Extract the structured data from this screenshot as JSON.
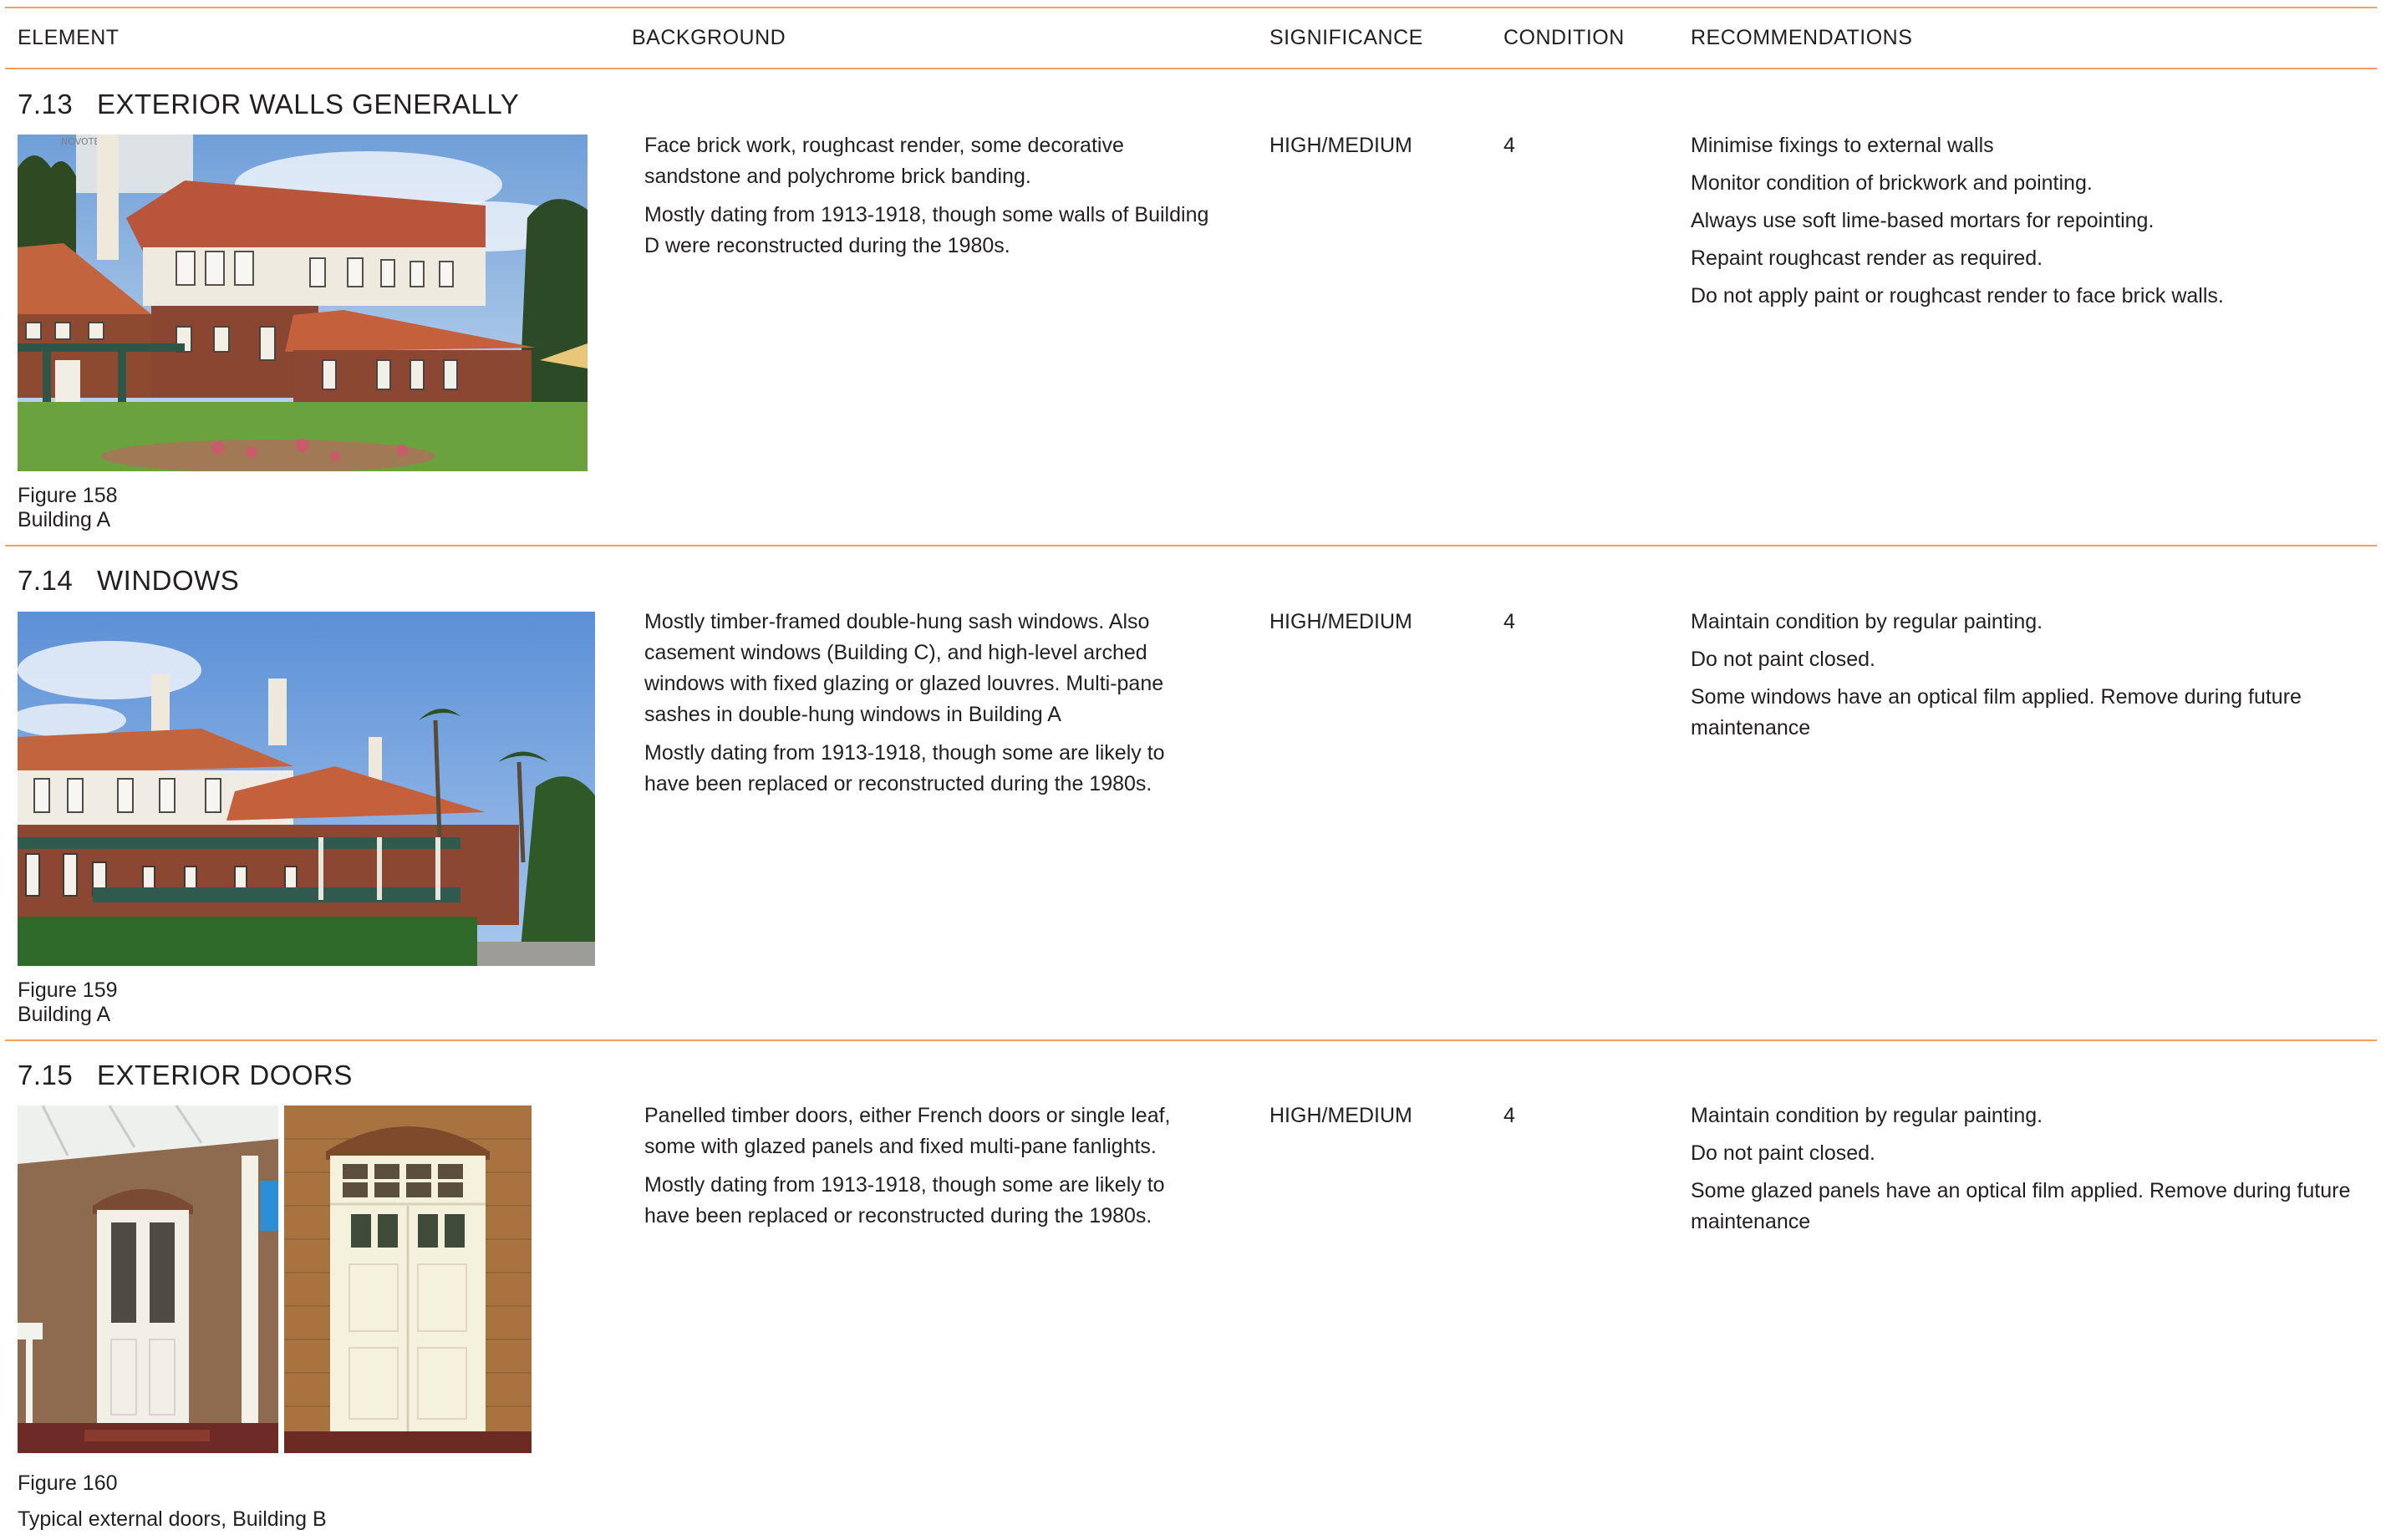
{
  "columns": {
    "element": "ELEMENT",
    "background": "BACKGROUND",
    "significance": "SIGNIFICANCE",
    "condition": "CONDITION",
    "recommendations": "RECOMMENDATIONS"
  },
  "sections": [
    {
      "number": "7.13",
      "title": "EXTERIOR WALLS GENERALLY",
      "background": [
        "Face brick work, roughcast render, some decorative sandstone and polychrome brick banding.",
        "Mostly dating from 1913-1918, though some walls of Building D were reconstructed during the 1980s."
      ],
      "significance": "HIGH/MEDIUM",
      "condition": "4",
      "recommendations": [
        "Minimise fixings to external walls",
        "Monitor condition of brickwork and pointing.",
        "Always use soft lime-based mortars for repointing.",
        "Repaint roughcast render as required.",
        "Do not apply paint or roughcast render to face brick walls."
      ],
      "figure_label": "Figure 158",
      "figure_caption": "Building A",
      "photo_sign": "NOVOTEL"
    },
    {
      "number": "7.14",
      "title": "WINDOWS",
      "background": [
        "Mostly timber-framed double-hung sash windows. Also casement windows (Building C), and high-level arched windows with fixed glazing or glazed louvres. Multi-pane sashes in double-hung windows in Building A",
        "Mostly dating from 1913-1918, though some are likely to have been replaced or reconstructed during the 1980s."
      ],
      "significance": "HIGH/MEDIUM",
      "condition": "4",
      "recommendations": [
        "Maintain condition by regular painting.",
        "Do not paint closed.",
        "Some windows have an optical film applied. Remove during future maintenance"
      ],
      "figure_label": "Figure 159",
      "figure_caption": "Building A"
    },
    {
      "number": "7.15",
      "title": "EXTERIOR DOORS",
      "background": [
        "Panelled timber doors, either French doors or single leaf, some with glazed panels and fixed multi-pane fanlights.",
        "Mostly dating from 1913-1918, though some are likely to have been replaced or reconstructed during the 1980s."
      ],
      "significance": "HIGH/MEDIUM",
      "condition": "4",
      "recommendations": [
        "Maintain condition by regular painting.",
        "Do not paint closed.",
        "Some glazed panels have an optical film applied. Remove during future maintenance"
      ],
      "figure_label": "Figure 160",
      "figure_caption": "Typical external doors, Building B"
    }
  ],
  "colors": {
    "rule": "#f0a060",
    "text": "#231f20"
  }
}
